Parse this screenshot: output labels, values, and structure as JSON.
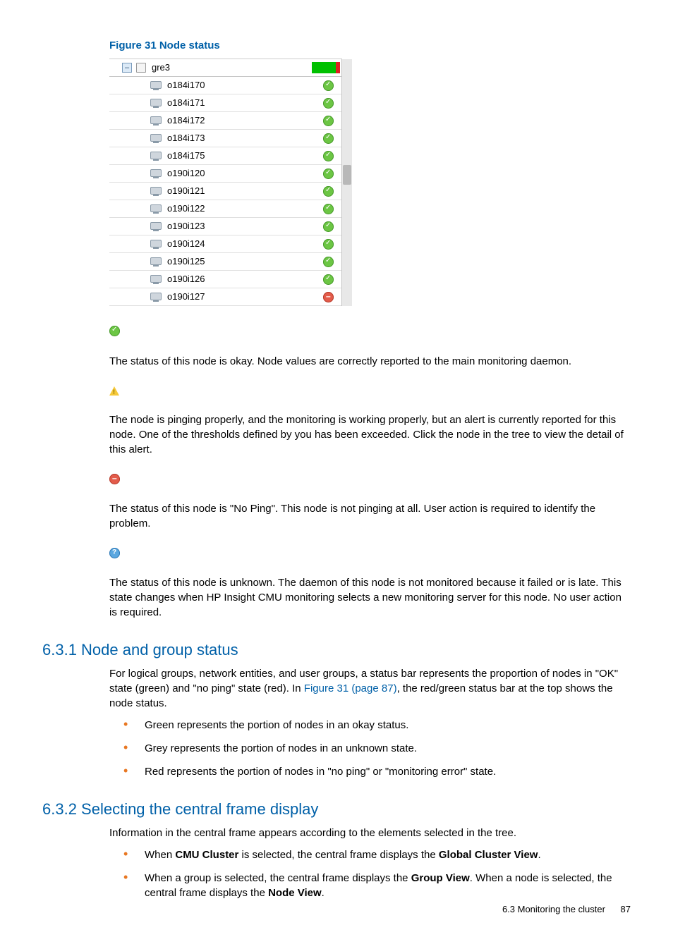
{
  "figure_caption": "Figure 31 Node status",
  "tree": {
    "group_label": "gre3",
    "nodes": [
      {
        "name": "o184i170",
        "status": "ok"
      },
      {
        "name": "o184i171",
        "status": "ok"
      },
      {
        "name": "o184i172",
        "status": "ok"
      },
      {
        "name": "o184i173",
        "status": "ok"
      },
      {
        "name": "o184i175",
        "status": "ok"
      },
      {
        "name": "o190i120",
        "status": "ok"
      },
      {
        "name": "o190i121",
        "status": "ok"
      },
      {
        "name": "o190i122",
        "status": "ok"
      },
      {
        "name": "o190i123",
        "status": "ok"
      },
      {
        "name": "o190i124",
        "status": "ok"
      },
      {
        "name": "o190i125",
        "status": "ok"
      },
      {
        "name": "o190i126",
        "status": "ok"
      },
      {
        "name": "o190i127",
        "status": "err"
      }
    ]
  },
  "legend": {
    "ok": "The status of this node is okay. Node values are correctly reported to the main monitoring daemon.",
    "warn": "The node is pinging properly, and the monitoring is working properly, but an alert is currently reported for this node. One of the thresholds defined by you has been exceeded. Click the node in the tree to view the detail of this alert.",
    "err": "The status of this node is \"No Ping\". This node is not pinging at all. User action is required to identify the problem.",
    "unk": "The status of this node is unknown. The daemon of this node is not monitored because it failed or is late. This state changes when HP Insight CMU monitoring selects a new monitoring server for this node. No user action is required."
  },
  "section631": {
    "title": "6.3.1 Node and group status",
    "intro_pre": "For logical groups, network entities, and user groups, a status bar represents the proportion of nodes in \"OK\" state (green) and \"no ping\" state (red). In ",
    "intro_link": "Figure 31 (page 87)",
    "intro_post": ", the red/green status bar at the top shows the node status.",
    "bullets": [
      "Green represents the portion of nodes in an okay status.",
      "Grey represents the portion of nodes in an unknown state.",
      "Red represents the portion of nodes in \"no ping\" or \"monitoring error\" state."
    ]
  },
  "section632": {
    "title": "6.3.2 Selecting the central frame display",
    "intro": "Information in the central frame appears according to the elements selected in the tree.",
    "bullets": [
      {
        "pre": "When ",
        "b1": "CMU Cluster",
        "mid": " is selected, the central frame displays the ",
        "b2": "Global Cluster View",
        "post": "."
      },
      {
        "pre": "When a group is selected, the central frame displays the ",
        "b1": "Group View",
        "mid": ". When a node is selected, the central frame displays the ",
        "b2": "Node View",
        "post": "."
      }
    ]
  },
  "footer": {
    "section": "6.3 Monitoring the cluster",
    "page": "87"
  }
}
